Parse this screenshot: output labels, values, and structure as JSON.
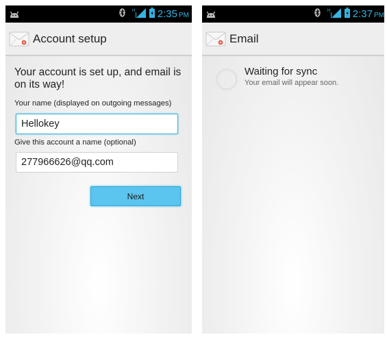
{
  "left_screen": {
    "status": {
      "time": "2:35",
      "ampm": "PM"
    },
    "action_bar": {
      "title": "Account setup",
      "icon": "email-envelope-icon"
    },
    "heading": "Your account is set up, and email is on its way!",
    "your_name": {
      "label": "Your name (displayed on outgoing messages)",
      "value": "Hellokey"
    },
    "account_name": {
      "label": "Give this account a name (optional)",
      "value": "277966626@qq.com"
    },
    "next_button": {
      "label": "Next"
    }
  },
  "right_screen": {
    "status": {
      "time": "2:37",
      "ampm": "PM"
    },
    "action_bar": {
      "title": "Email",
      "icon": "email-envelope-icon"
    },
    "sync": {
      "title": "Waiting for sync",
      "subtitle": "Your email will appear soon."
    }
  },
  "colors": {
    "accent": "#33b5e5",
    "button": "#5bc4ef",
    "status_bar": "#000000",
    "action_bar": "#eeeeee"
  }
}
